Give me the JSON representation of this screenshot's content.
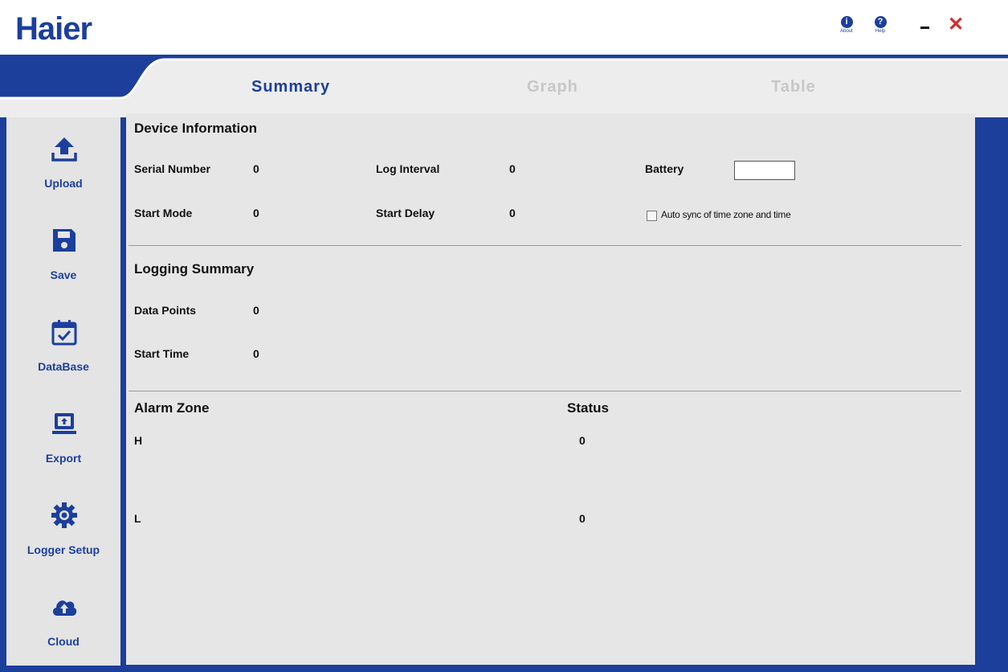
{
  "app": {
    "logo": "Haier"
  },
  "window": {
    "about_label": "About",
    "help_label": "Help",
    "about_glyph": "i",
    "help_glyph": "?",
    "close_glyph": "✕"
  },
  "tabs": [
    {
      "label": "Summary",
      "active": true
    },
    {
      "label": "Graph",
      "active": false
    },
    {
      "label": "Table",
      "active": false
    }
  ],
  "sidebar": {
    "items": [
      {
        "label": "Upload",
        "icon": "upload-icon"
      },
      {
        "label": "Save",
        "icon": "floppy-disk-icon"
      },
      {
        "label": "DataBase",
        "icon": "calendar-check-icon"
      },
      {
        "label": "Export",
        "icon": "laptop-upload-icon"
      },
      {
        "label": "Logger Setup",
        "icon": "gear-icon"
      },
      {
        "label": "Cloud",
        "icon": "cloud-upload-icon"
      }
    ]
  },
  "device_info": {
    "title": "Device Information",
    "serial_number_label": "Serial Number",
    "serial_number_value": "0",
    "log_interval_label": "Log Interval",
    "log_interval_value": "0",
    "battery_label": "Battery",
    "start_mode_label": "Start Mode",
    "start_mode_value": "0",
    "start_delay_label": "Start Delay",
    "start_delay_value": "0",
    "auto_sync_label": "Auto sync of time zone and time",
    "auto_sync_checked": false
  },
  "logging_summary": {
    "title": "Logging Summary",
    "data_points_label": "Data Points",
    "data_points_value": "0",
    "start_time_label": "Start Time",
    "start_time_value": "0"
  },
  "alarm": {
    "zone_header": "Alarm Zone",
    "status_header": "Status",
    "rows": [
      {
        "zone": "H",
        "status": "0"
      },
      {
        "zone": "L",
        "status": "0"
      }
    ]
  },
  "colors": {
    "brand": "#1c3f9c",
    "close": "#d52b2b",
    "inactive_tab": "#c7c7c7"
  }
}
